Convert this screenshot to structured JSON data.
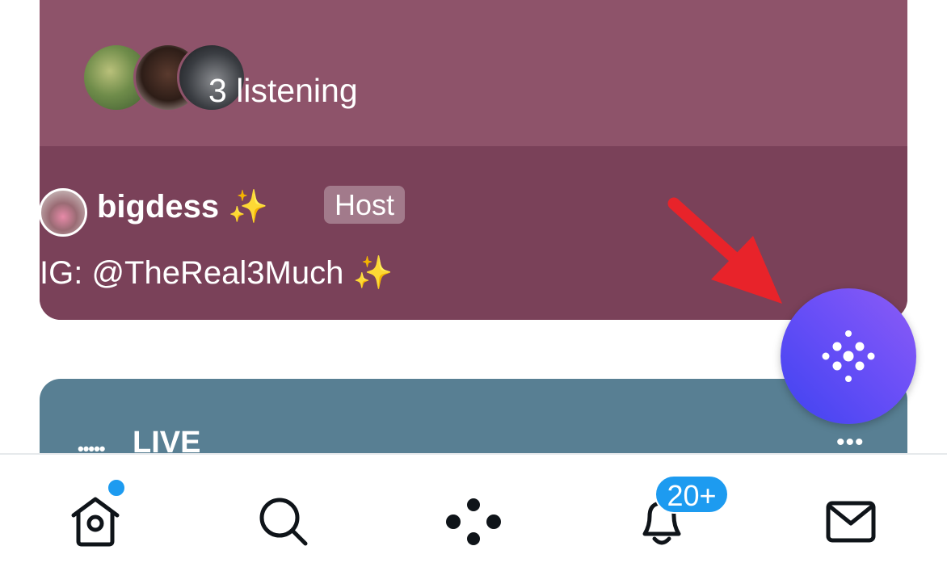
{
  "space_card": {
    "listening_text": "3 listening",
    "host": {
      "name": "bigdess",
      "name_emoji": "✨",
      "role_badge": "Host",
      "bio": "IG: @TheReal3Much",
      "bio_emoji": "✨"
    }
  },
  "live_card": {
    "dots": "•••••",
    "label": "LIVE",
    "more": "•••"
  },
  "bottom_nav": {
    "items": [
      {
        "icon": "home-icon"
      },
      {
        "icon": "search-icon"
      },
      {
        "icon": "spaces-icon"
      },
      {
        "icon": "bell-icon"
      },
      {
        "icon": "mail-icon"
      }
    ],
    "notifications_badge": "20+"
  },
  "fab": {
    "icon": "spaces-compose-icon"
  },
  "colors": {
    "card_top": "#8e536a",
    "card_bottom": "#7a4159",
    "live_card": "#587f93",
    "accent_blue": "#1d9bf0",
    "fab_gradient_start": "#8d5cf6",
    "fab_gradient_end": "#3f43f0",
    "annotation_arrow": "#e8232a"
  }
}
